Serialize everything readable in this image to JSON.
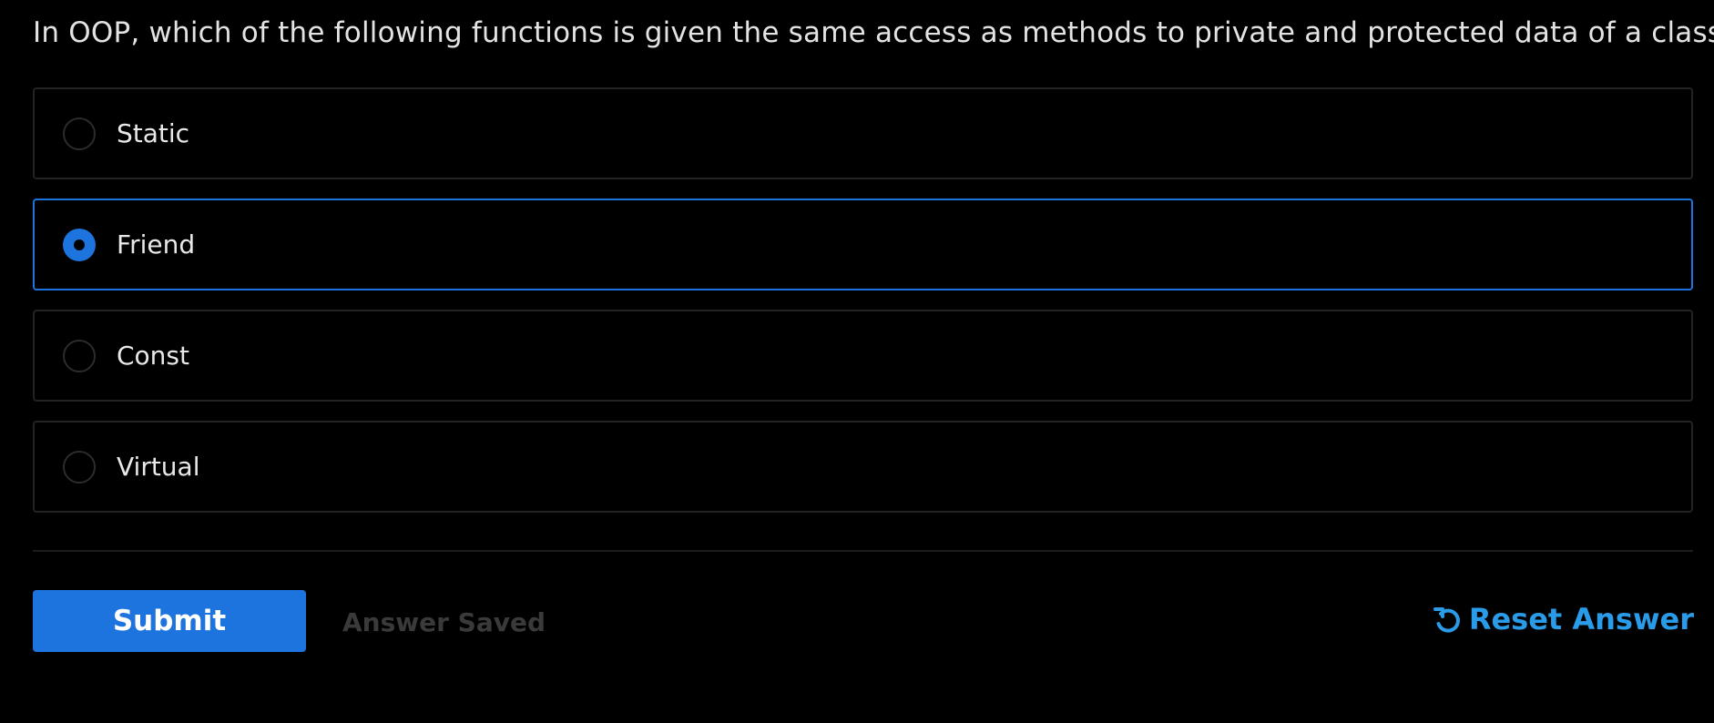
{
  "question": {
    "text": "In OOP, which of the following functions is given the same access as methods to private and protected data of a class?"
  },
  "options": [
    {
      "label": "Static",
      "selected": false
    },
    {
      "label": "Friend",
      "selected": true
    },
    {
      "label": "Const",
      "selected": false
    },
    {
      "label": "Virtual",
      "selected": false
    }
  ],
  "actions": {
    "submit_label": "Submit",
    "status_text": "Answer Saved",
    "reset_label": "Reset Answer",
    "reset_icon": "reset-icon"
  },
  "colors": {
    "accent": "#1d74df",
    "link": "#2a9be8",
    "background": "#000000"
  }
}
